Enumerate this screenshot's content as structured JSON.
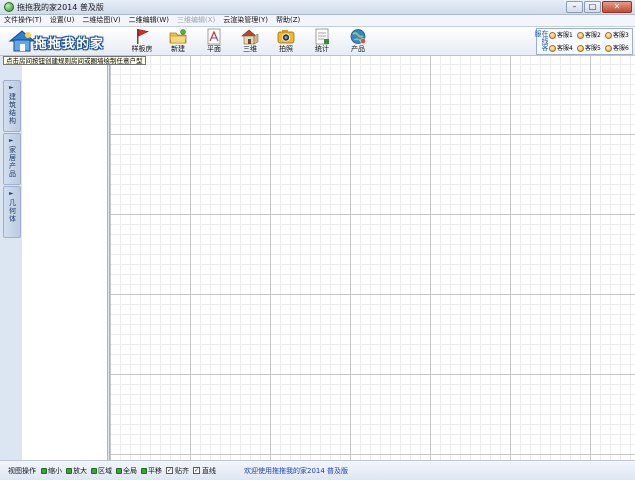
{
  "window": {
    "title": "拖拖我的家2014 普及版"
  },
  "menu": [
    {
      "label": "文件操作(T)",
      "enabled": true
    },
    {
      "label": "设置(U)",
      "enabled": true
    },
    {
      "label": "二维绘图(V)",
      "enabled": true
    },
    {
      "label": "二维编辑(W)",
      "enabled": true
    },
    {
      "label": "三维编辑(X)",
      "enabled": false
    },
    {
      "label": "云渲染管理(Y)",
      "enabled": true
    },
    {
      "label": "帮助(Z)",
      "enabled": true
    }
  ],
  "logo": {
    "text": "拖拖我的家"
  },
  "toolbar": {
    "tools": [
      {
        "label": "样板房",
        "icon": "flag-icon"
      },
      {
        "label": "新建",
        "icon": "new-folder-icon"
      },
      {
        "label": "平面",
        "icon": "floor-plan-icon"
      },
      {
        "label": "三维",
        "icon": "house-3d-icon"
      },
      {
        "label": "拍照",
        "icon": "camera-icon"
      },
      {
        "label": "统计",
        "icon": "statistics-icon"
      },
      {
        "label": "产品",
        "icon": "products-icon"
      }
    ]
  },
  "service": {
    "title": "在线客服",
    "items": [
      "客服1",
      "客服2",
      "客服3",
      "客服4",
      "客服5",
      "客服6"
    ]
  },
  "tooltip": {
    "text": "点击房间按钮创建规则房间或圈墙绘制任意户型"
  },
  "side_tabs": [
    {
      "label": "建筑结构"
    },
    {
      "label": "家居产品"
    },
    {
      "label": "几何体"
    }
  ],
  "statusbar": {
    "group_label": "视图操作",
    "buttons": [
      "缩小",
      "放大",
      "区域",
      "全局",
      "平移"
    ],
    "checks": [
      {
        "label": "贴齐",
        "checked": true
      },
      {
        "label": "直线",
        "checked": true
      }
    ],
    "message": "欢迎使用拖拖我的家2014 普及版"
  },
  "colors": {
    "accent": "#1f5fb2",
    "status_link": "#1f3fb5"
  }
}
